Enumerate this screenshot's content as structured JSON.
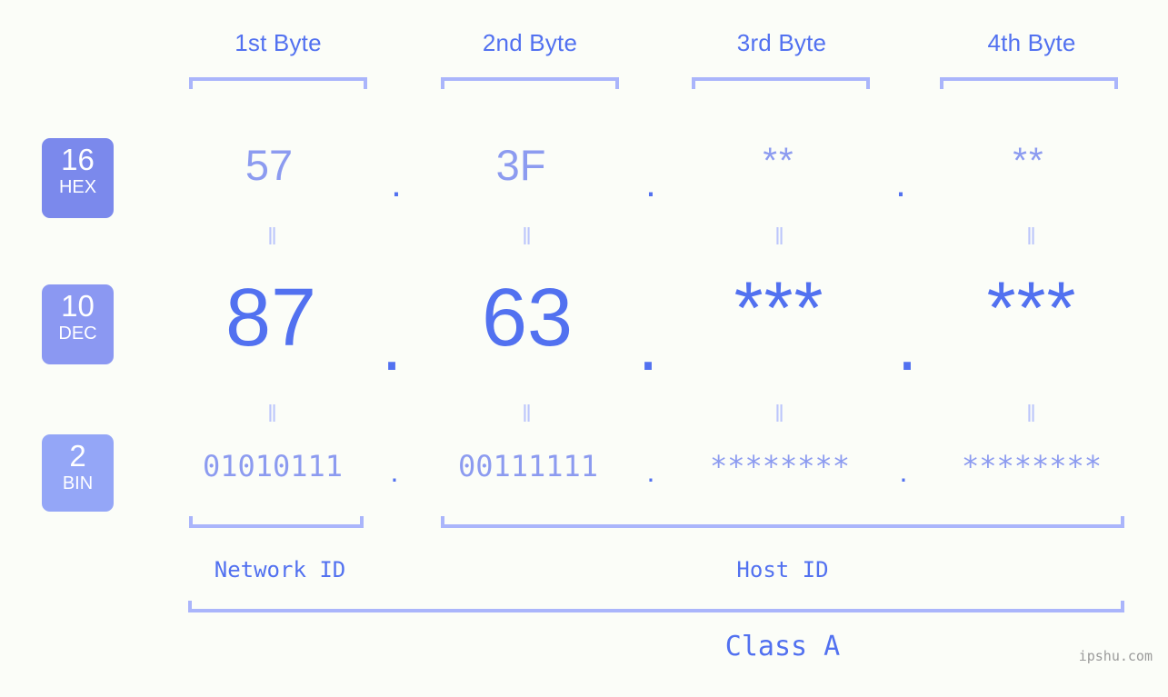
{
  "canvas": {
    "background": "#fbfdf8",
    "accent": "#5271f0",
    "accent_light": "#8c9bf0",
    "bracket_color": "#aab5fb",
    "eq_color": "#bcc6fb"
  },
  "byte_headers": [
    {
      "label": "1st Byte"
    },
    {
      "label": "2nd Byte"
    },
    {
      "label": "3rd Byte"
    },
    {
      "label": "4th Byte"
    }
  ],
  "bases": [
    {
      "number": "16",
      "abbr": "HEX",
      "color": "#7b89ec"
    },
    {
      "number": "10",
      "abbr": "DEC",
      "color": "#8b98f2"
    },
    {
      "number": "2",
      "abbr": "BIN",
      "color": "#94a6f7"
    }
  ],
  "rows": {
    "hex": {
      "values": [
        "57",
        "3F",
        "**",
        "**"
      ],
      "separator": "."
    },
    "dec": {
      "values": [
        "87",
        "63",
        "***",
        "***"
      ],
      "separator": "."
    },
    "bin": {
      "values": [
        "01010111",
        "00111111",
        "********",
        "********"
      ],
      "separator": "."
    }
  },
  "equality_marks": {
    "glyph": "‖"
  },
  "sections": {
    "network_id": "Network ID",
    "host_id": "Host ID",
    "class": "Class A"
  },
  "watermark": "ipshu.com",
  "chart_data": {
    "type": "table",
    "title": "Class A",
    "categories": [
      "1st Byte",
      "2nd Byte",
      "3rd Byte",
      "4th Byte"
    ],
    "series": [
      {
        "name": "HEX",
        "values": [
          "57",
          "3F",
          "**",
          "**"
        ]
      },
      {
        "name": "DEC",
        "values": [
          "87",
          "63",
          "***",
          "***"
        ]
      },
      {
        "name": "BIN",
        "values": [
          "01010111",
          "00111111",
          "********",
          "********"
        ]
      }
    ],
    "annotations": [
      "Network ID",
      "Host ID",
      "Class A"
    ]
  }
}
